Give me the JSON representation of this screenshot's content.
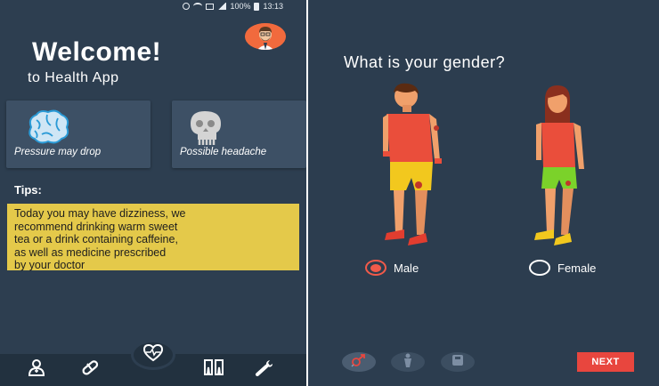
{
  "status_bar": {
    "battery": "100%",
    "time": "13:13"
  },
  "left_screen": {
    "welcome_title": "Welcome!",
    "welcome_subtitle": "to Health App",
    "cards": [
      {
        "label": "Pressure may drop",
        "icon": "brain-icon"
      },
      {
        "label": "Possible headache",
        "icon": "skull-icon"
      }
    ],
    "tips_title": "Tips:",
    "tip_lines": [
      "Today you may have dizziness, we",
      "recommend drinking warm sweet",
      "tea or a drink containing caffeine,",
      "as well as medicine prescribed",
      "by your doctor"
    ],
    "bottom_nav": [
      "doctor-icon",
      "pill-icon",
      "heart-pulse-icon",
      "teeth-icon",
      "wrench-icon"
    ]
  },
  "right_screen": {
    "question": "What is your gender?",
    "options": [
      {
        "label": "Male",
        "selected": true
      },
      {
        "label": "Female",
        "selected": false
      }
    ],
    "steps": [
      "gender-icon",
      "person-icon",
      "scale-icon"
    ],
    "active_step": 1,
    "next_label": "NEXT"
  },
  "colors": {
    "left_bg": "#2d3e50",
    "card_bg": "#3d5065",
    "tip_bg": "#e4c94a",
    "accent": "#e8463e",
    "avatar_bg": "#f16a3d"
  }
}
